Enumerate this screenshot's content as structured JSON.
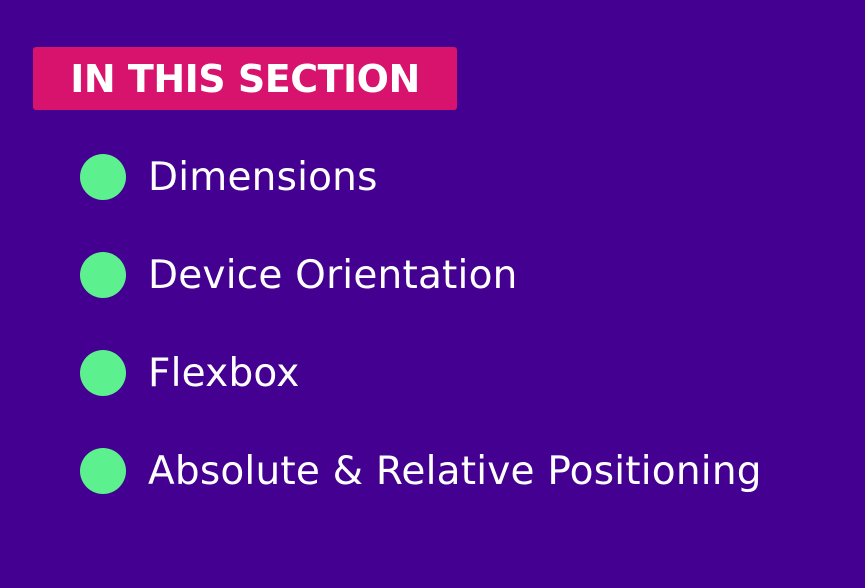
{
  "colors": {
    "background": "#440090",
    "badge": "#d8136d",
    "bullet": "#5df08f",
    "text": "#ffffff"
  },
  "header": {
    "label": "IN THIS SECTION"
  },
  "topics": [
    {
      "label": "Dimensions",
      "icon": "green-circle-bullet"
    },
    {
      "label": "Device Orientation",
      "icon": "green-circle-bullet"
    },
    {
      "label": "Flexbox",
      "icon": "green-circle-bullet"
    },
    {
      "label": "Absolute & Relative Positioning",
      "icon": "green-circle-bullet"
    }
  ]
}
